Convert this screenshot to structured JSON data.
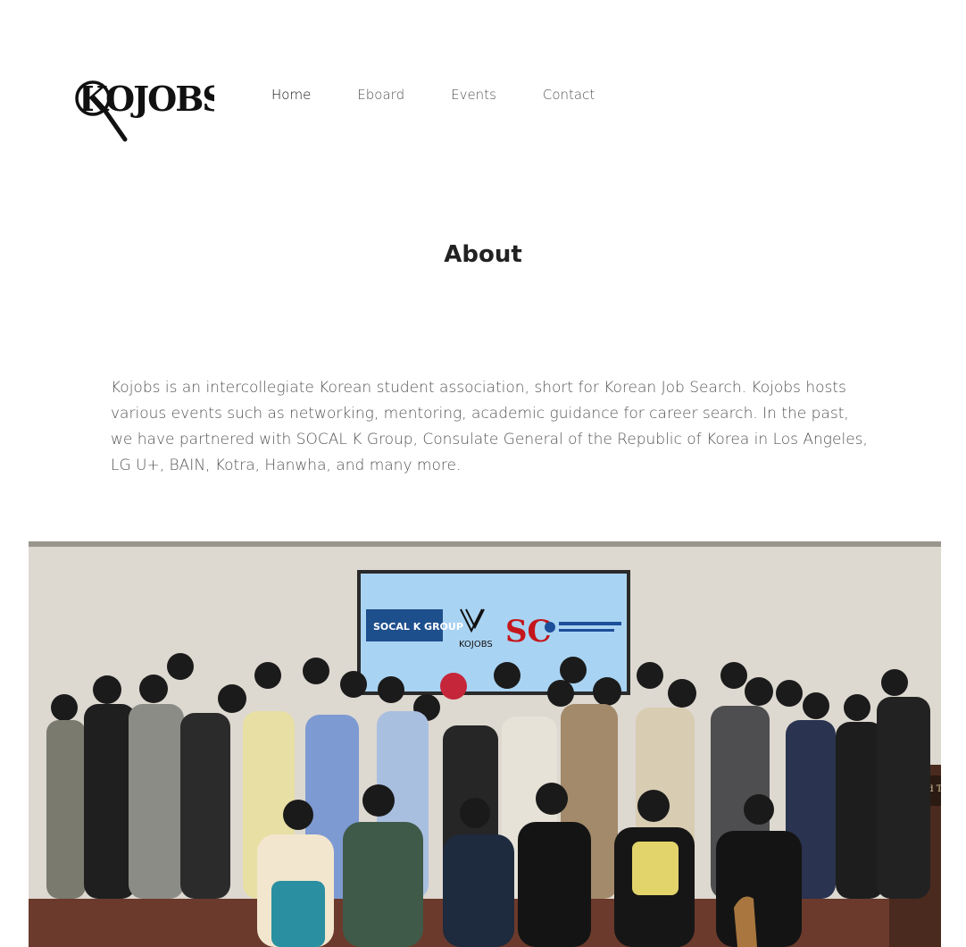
{
  "header": {
    "logo_text": "KOJOBS"
  },
  "nav": {
    "items": [
      {
        "label": "Home",
        "active": true
      },
      {
        "label": "Eboard",
        "active": false
      },
      {
        "label": "Events",
        "active": false
      },
      {
        "label": "Contact",
        "active": false
      }
    ]
  },
  "about": {
    "title": "About",
    "body": "Kojobs is an intercollegiate Korean student association, short for Korean Job Search. Kojobs hosts various events such as networking, mentoring, academic guidance for career search. In the past, we have partnered with SOCAL K Group, Consulate General of the Republic of Korea in Los Angeles, LG U+, BAIN, Kotra, Hanwha, and many more."
  },
  "photo": {
    "screen_logos": [
      "SOCAL K GROUP",
      "KOJOBS",
      "SC"
    ],
    "podium_sign": "Ronald T"
  }
}
